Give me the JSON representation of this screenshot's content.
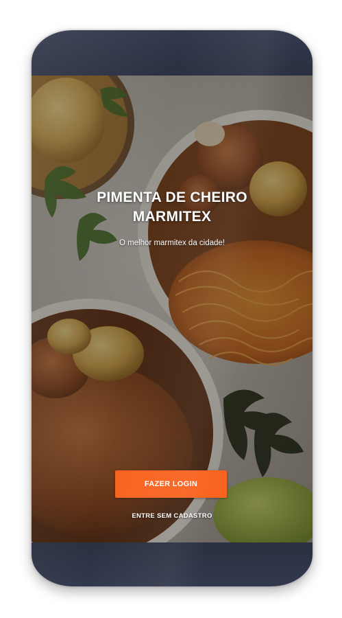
{
  "app": {
    "title_line1": "PIMENTA DE CHEIRO",
    "title_line2": "MARMITEX",
    "tagline": "O melhor marmitex da cidade!"
  },
  "actions": {
    "login_label": "FAZER LOGIN",
    "guest_label": "ENTRE SEM CADASTRO"
  },
  "colors": {
    "accent": "#f8631f",
    "frame": "#262b3c",
    "text": "#ffffff"
  },
  "icons": {
    "background": "food-photo"
  }
}
